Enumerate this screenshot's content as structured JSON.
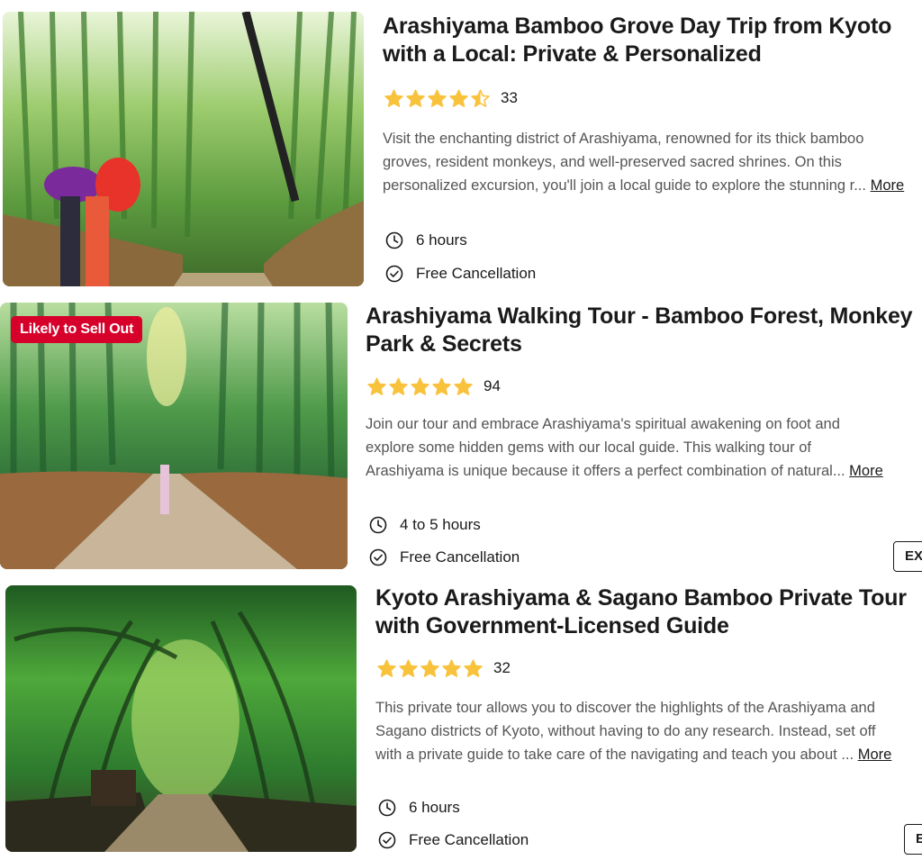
{
  "listings": [
    {
      "title_line1": "Arashiyama Bamboo Grove Day Trip from Kyoto",
      "title_line2": "with a Local: Private & Personalized",
      "rating": 4.5,
      "review_count": "33",
      "desc_line1": "Visit the enchanting district of Arashiyama, renowned for its thick bamboo",
      "desc_line2": "groves, resident monkeys, and well-preserved sacred shrines. On this",
      "desc_line3": "personalized excursion, you'll join a local guide to explore the stunning r...",
      "more_label": "More",
      "duration": "6 hours",
      "cancellation": "Free Cancellation",
      "duration_icon": "clock-icon",
      "cancellation_icon": "check-circle-icon"
    },
    {
      "badge": "Likely to Sell Out",
      "badge_color": "#d6002a",
      "title_line1": "Arashiyama Walking Tour - Bamboo Forest, Monkey",
      "title_line2": "Park & Secrets",
      "rating": 5,
      "review_count": "94",
      "desc_line1": "Join our tour and embrace Arashiyama's spiritual awakening on foot and",
      "desc_line2": "explore some hidden gems with our local guide. This walking tour of",
      "desc_line3": "Arashiyama is unique because it offers a perfect combination of natural...",
      "more_label": "More",
      "duration": "4 to 5 hours",
      "cancellation": "Free Cancellation",
      "button_label": "EXPLORE",
      "duration_icon": "clock-icon",
      "cancellation_icon": "check-circle-icon"
    },
    {
      "title_line1": "Kyoto Arashiyama & Sagano Bamboo Private Tour",
      "title_line2": "with Government-Licensed Guide",
      "rating": 5,
      "review_count": "32",
      "desc_line1": "This private tour allows you to discover the highlights of the Arashiyama and",
      "desc_line2": "Sagano districts of Kyoto, without having to do any research. Instead, set off",
      "desc_line3": "with a private guide to take care of the navigating and teach you about ...",
      "more_label": "More",
      "duration": "6 hours",
      "cancellation": "Free Cancellation",
      "button_label": "EXPLORE",
      "duration_icon": "clock-icon",
      "cancellation_icon": "check-circle-icon"
    }
  ],
  "star_color": "#f9c23c"
}
